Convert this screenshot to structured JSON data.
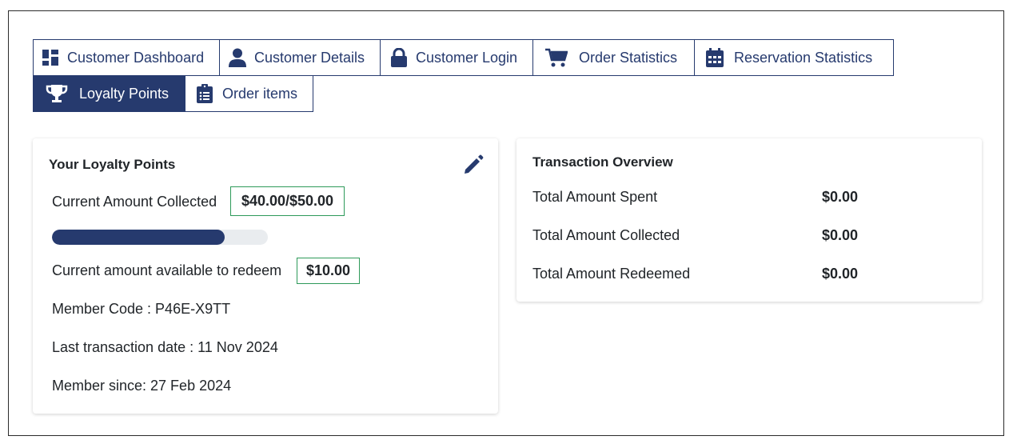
{
  "tabs": [
    {
      "label": "Customer Dashboard",
      "icon": "dashboard-icon"
    },
    {
      "label": "Customer Details",
      "icon": "user-icon"
    },
    {
      "label": "Customer Login",
      "icon": "lock-icon"
    },
    {
      "label": "Order Statistics",
      "icon": "cart-icon"
    },
    {
      "label": "Reservation Statistics",
      "icon": "calendar-icon"
    },
    {
      "label": "Loyalty Points",
      "icon": "trophy-icon",
      "active": true
    },
    {
      "label": "Order items",
      "icon": "clipboard-list-icon"
    }
  ],
  "loyalty": {
    "title": "Your Loyalty Points",
    "collected_label": "Current Amount Collected",
    "collected_value": "$40.00/$50.00",
    "progress_fraction": 0.8,
    "redeem_label": "Current amount available to redeem",
    "redeem_value": "$10.00",
    "member_code": "Member Code : P46E-X9TT",
    "last_transaction": "Last transaction date : 11 Nov 2024",
    "member_since": "Member since: 27 Feb 2024",
    "edit_icon": "pencil-icon"
  },
  "overview": {
    "title": "Transaction Overview",
    "rows": [
      {
        "label": "Total Amount Spent",
        "value": "$0.00"
      },
      {
        "label": "Total Amount Collected",
        "value": "$0.00"
      },
      {
        "label": "Total Amount Redeemed",
        "value": "$0.00"
      }
    ]
  },
  "colors": {
    "primary": "#263a6e",
    "highlight_border": "#2e9a5a"
  }
}
